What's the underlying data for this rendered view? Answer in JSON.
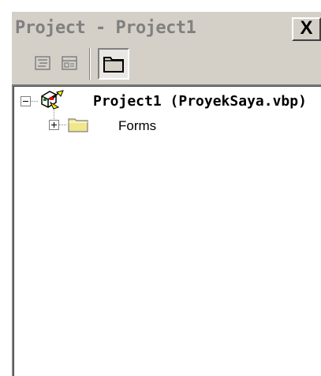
{
  "window": {
    "title": "Project - Project1",
    "close_label": "X"
  },
  "toolbar": {
    "buttons": [
      {
        "name": "view-code",
        "icon": "view-code-icon"
      },
      {
        "name": "view-object",
        "icon": "view-object-icon"
      },
      {
        "name": "toggle-folders",
        "icon": "folder-icon",
        "pressed": true
      }
    ]
  },
  "tree": {
    "root": {
      "label": "Project1 (ProyekSaya.vbp)",
      "icon": "project-icon",
      "expanded": true
    },
    "children": [
      {
        "label": "Forms",
        "icon": "folder-icon",
        "expanded": false
      }
    ]
  },
  "colors": {
    "chrome": "#d4d0c8",
    "title_text": "#808080",
    "folder": "#f0e68c"
  }
}
